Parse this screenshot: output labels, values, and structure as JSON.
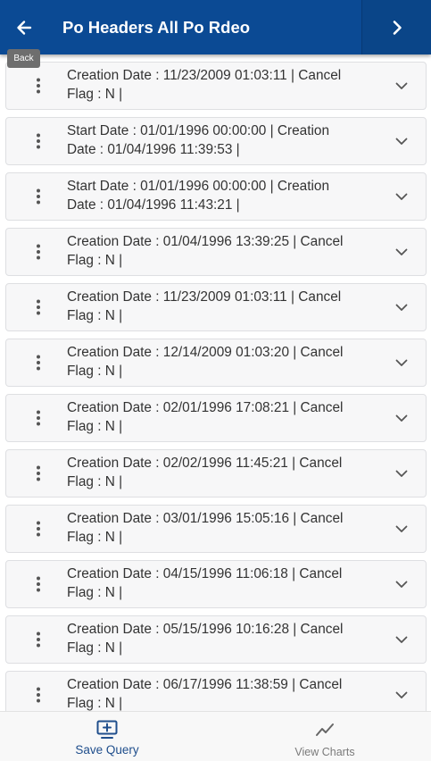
{
  "header": {
    "title": "Po Headers All Po Rdeo",
    "back_tooltip": "Back"
  },
  "records": [
    {
      "line1": "Creation Date  : 11/23/2009 01:03:11 | Cancel",
      "line2": "Flag  : N |"
    },
    {
      "line1": "Start Date  : 01/01/1996 00:00:00 | Creation",
      "line2": "Date  : 01/04/1996 11:39:53 |"
    },
    {
      "line1": "Start Date  : 01/01/1996 00:00:00 | Creation",
      "line2": "Date  : 01/04/1996 11:43:21 |"
    },
    {
      "line1": "Creation Date  : 01/04/1996 13:39:25 | Cancel",
      "line2": "Flag  : N |"
    },
    {
      "line1": "Creation Date  : 11/23/2009 01:03:11 | Cancel",
      "line2": "Flag  : N |"
    },
    {
      "line1": "Creation Date  : 12/14/2009 01:03:20 | Cancel",
      "line2": "Flag  : N |"
    },
    {
      "line1": "Creation Date  : 02/01/1996 17:08:21 | Cancel",
      "line2": "Flag  : N |"
    },
    {
      "line1": "Creation Date  : 02/02/1996 11:45:21 | Cancel",
      "line2": "Flag  : N |"
    },
    {
      "line1": "Creation Date  : 03/01/1996 15:05:16 | Cancel",
      "line2": "Flag  : N |"
    },
    {
      "line1": "Creation Date  : 04/15/1996 11:06:18 | Cancel",
      "line2": "Flag  : N |"
    },
    {
      "line1": "Creation Date  : 05/15/1996 10:16:28 | Cancel",
      "line2": "Flag  : N |"
    },
    {
      "line1": "Creation Date  : 06/17/1996 11:38:59 | Cancel",
      "line2": "Flag  : N |"
    }
  ],
  "footer": {
    "save_query_label": "Save Query",
    "view_charts_label": "View Charts"
  },
  "icons": {
    "back": "arrow-left-icon",
    "next": "chevron-right-icon",
    "row_menu": "kebab-menu-icon",
    "row_expand": "chevron-down-icon",
    "save_query": "add-to-screen-icon",
    "view_charts": "line-chart-icon"
  },
  "colors": {
    "header_bg": "#0b4a94",
    "accent": "#1f4e8c",
    "card_bg": "#f7f7f8",
    "text": "#333333",
    "muted": "#7a7a7a"
  }
}
